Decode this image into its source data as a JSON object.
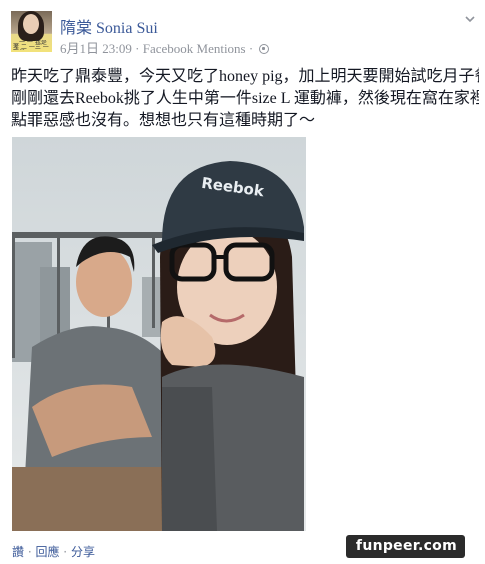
{
  "post": {
    "author_name": "隋棠 Sonia Sui",
    "timestamp": "6月1日 23:09",
    "separator": "·",
    "source": "Facebook Mentions",
    "privacy_icon": "globe-icon",
    "menu_icon": "chevron-down-icon",
    "avatar_caption": "二一 一 我是孝 二 一三 一 陽光…",
    "text_lines": [
      "昨天吃了鼎泰豐，今天又吃了honey pig，加上明天要開始試吃月子餐，",
      "剛剛還去Reebok挑了人生中第一件size L 運動褲，然後現在窩在家裡一",
      "點罪惡感也沒有。想想也只有這種時期了～"
    ]
  },
  "photo": {
    "cap_logo_text": "Reebok"
  },
  "actions": {
    "like": "讚",
    "comment": "回應",
    "share": "分享",
    "separator": " · "
  },
  "watermark": {
    "text": "funpeer.com"
  },
  "colors": {
    "link_blue": "#3b5998",
    "meta_gray": "#90949c",
    "text_dark": "#141823"
  }
}
